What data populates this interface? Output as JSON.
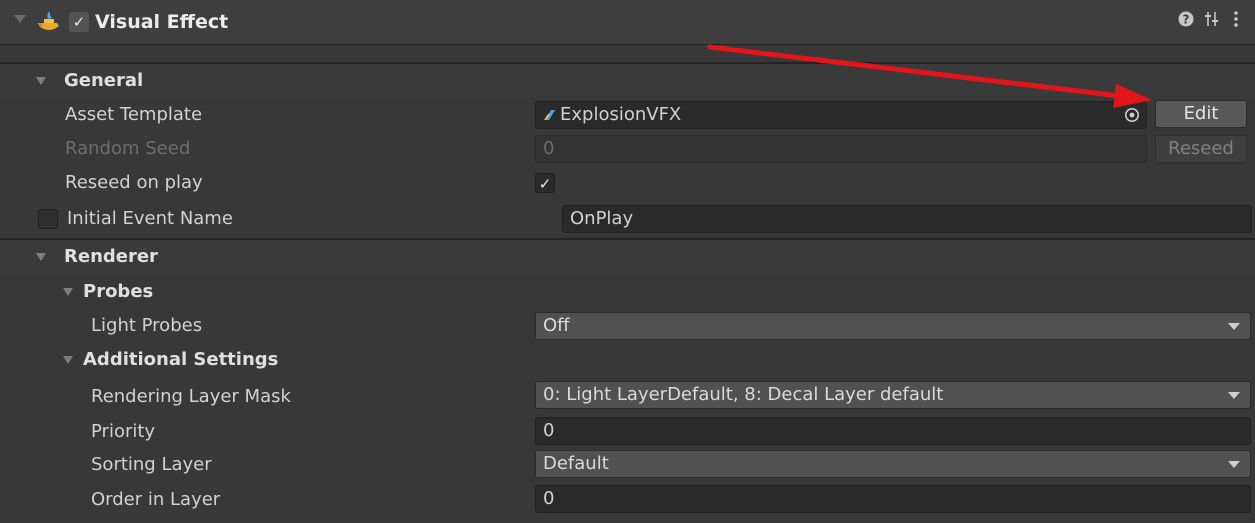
{
  "component": {
    "title": "Visual Effect",
    "enabled": true,
    "header_icons": [
      "help-icon",
      "preset-icon",
      "more-icon"
    ]
  },
  "general": {
    "title": "General",
    "asset_template": {
      "label": "Asset Template",
      "value": "ExplosionVFX",
      "edit_label": "Edit"
    },
    "random_seed": {
      "label": "Random Seed",
      "value": "0",
      "reseed_label": "Reseed"
    },
    "reseed_on_play": {
      "label": "Reseed on play",
      "checked": true
    },
    "initial_event": {
      "label": "Initial Event Name",
      "value": "OnPlay",
      "enabled": false
    }
  },
  "renderer": {
    "title": "Renderer",
    "probes": {
      "title": "Probes",
      "light_probes": {
        "label": "Light Probes",
        "value": "Off"
      }
    },
    "additional": {
      "title": "Additional Settings",
      "rendering_layer_mask": {
        "label": "Rendering Layer Mask",
        "value": "0: Light LayerDefault, 8: Decal Layer default"
      },
      "priority": {
        "label": "Priority",
        "value": "0"
      },
      "sorting_layer": {
        "label": "Sorting Layer",
        "value": "Default"
      },
      "order_in_layer": {
        "label": "Order in Layer",
        "value": "0"
      }
    }
  },
  "colors": {
    "annotation_arrow": "#e3141a",
    "vfx_icon": "#4aa3f0"
  }
}
